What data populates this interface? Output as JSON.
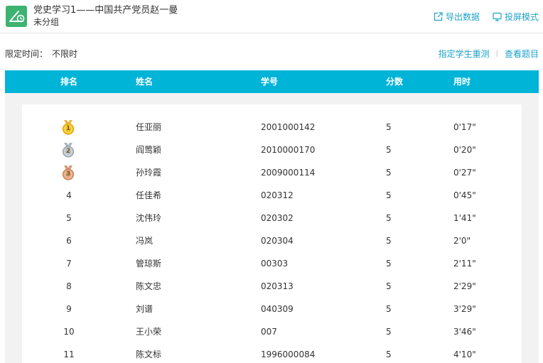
{
  "header": {
    "title": "党史学习1——中国共产党员赵一曼",
    "subtitle": "未分组",
    "export_label": "导出数据",
    "projection_label": "投屏模式"
  },
  "limit": {
    "label": "限定时间：",
    "value": "不限时"
  },
  "links": {
    "retest_label": "指定学生重测",
    "separator": "|",
    "view_label": "查看题目"
  },
  "table": {
    "columns": [
      "排名",
      "姓名",
      "学号",
      "分数",
      "用时"
    ],
    "rows": [
      {
        "rank": "1",
        "medal": "gold",
        "name": "任亚丽",
        "id": "2001000142",
        "score": "5",
        "time": "0'17\""
      },
      {
        "rank": "2",
        "medal": "silver",
        "name": "阎莺颖",
        "id": "2010000170",
        "score": "5",
        "time": "0'20\""
      },
      {
        "rank": "3",
        "medal": "bronze",
        "name": "孙玲霞",
        "id": "2009000114",
        "score": "5",
        "time": "0'27\""
      },
      {
        "rank": "4",
        "medal": "",
        "name": "任佳希",
        "id": "020312",
        "score": "5",
        "time": "0'45\""
      },
      {
        "rank": "5",
        "medal": "",
        "name": "沈伟玲",
        "id": "020302",
        "score": "5",
        "time": "1'41\""
      },
      {
        "rank": "6",
        "medal": "",
        "name": "冯岚",
        "id": "020304",
        "score": "5",
        "time": "2'0\""
      },
      {
        "rank": "7",
        "medal": "",
        "name": "管琼斯",
        "id": "00303",
        "score": "5",
        "time": "2'11\""
      },
      {
        "rank": "8",
        "medal": "",
        "name": "陈文忠",
        "id": "020313",
        "score": "5",
        "time": "2'29\""
      },
      {
        "rank": "9",
        "medal": "",
        "name": "刘谱",
        "id": "040309",
        "score": "5",
        "time": "3'29\""
      },
      {
        "rank": "10",
        "medal": "",
        "name": "王小荣",
        "id": "007",
        "score": "5",
        "time": "3'46\""
      },
      {
        "rank": "11",
        "medal": "",
        "name": "陈文标",
        "id": "1996000084",
        "score": "5",
        "time": "4'10\""
      }
    ]
  },
  "colors": {
    "accent": "#1ea2c8",
    "header_bar": "#00b4d8",
    "app_icon": "#3cb371",
    "gold": "#f4c321",
    "silver": "#b8c2cc",
    "bronze": "#e0a07a"
  }
}
